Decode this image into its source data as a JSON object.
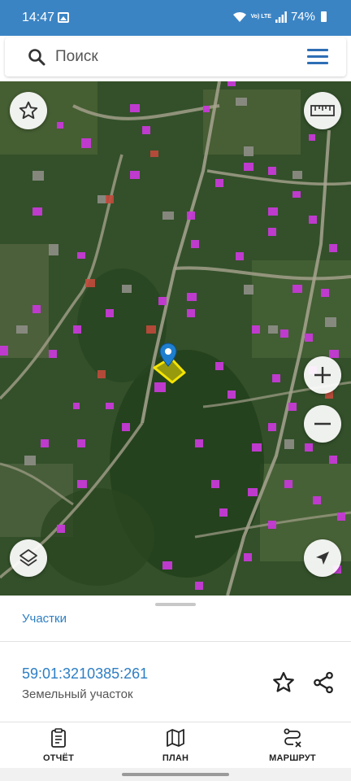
{
  "status_bar": {
    "time": "14:47",
    "network": "Vo) LTE",
    "battery": "74%"
  },
  "search": {
    "placeholder": "Поиск"
  },
  "map": {
    "imagery": "satellite",
    "selected_parcel_color": "#f5e400",
    "marker_color": "#1f7fcf",
    "building_overlay_color": "#c63ad6"
  },
  "sheet": {
    "tab_label": "Участки",
    "cadastral_number": "59:01:3210385:261",
    "parcel_type": "Земельный участок"
  },
  "bottom_nav": {
    "report": "ОТЧЁТ",
    "plan": "ПЛАН",
    "route": "МАРШРУТ"
  },
  "colors": {
    "status_bar": "#3b84c4",
    "accent": "#2d7ec4"
  }
}
